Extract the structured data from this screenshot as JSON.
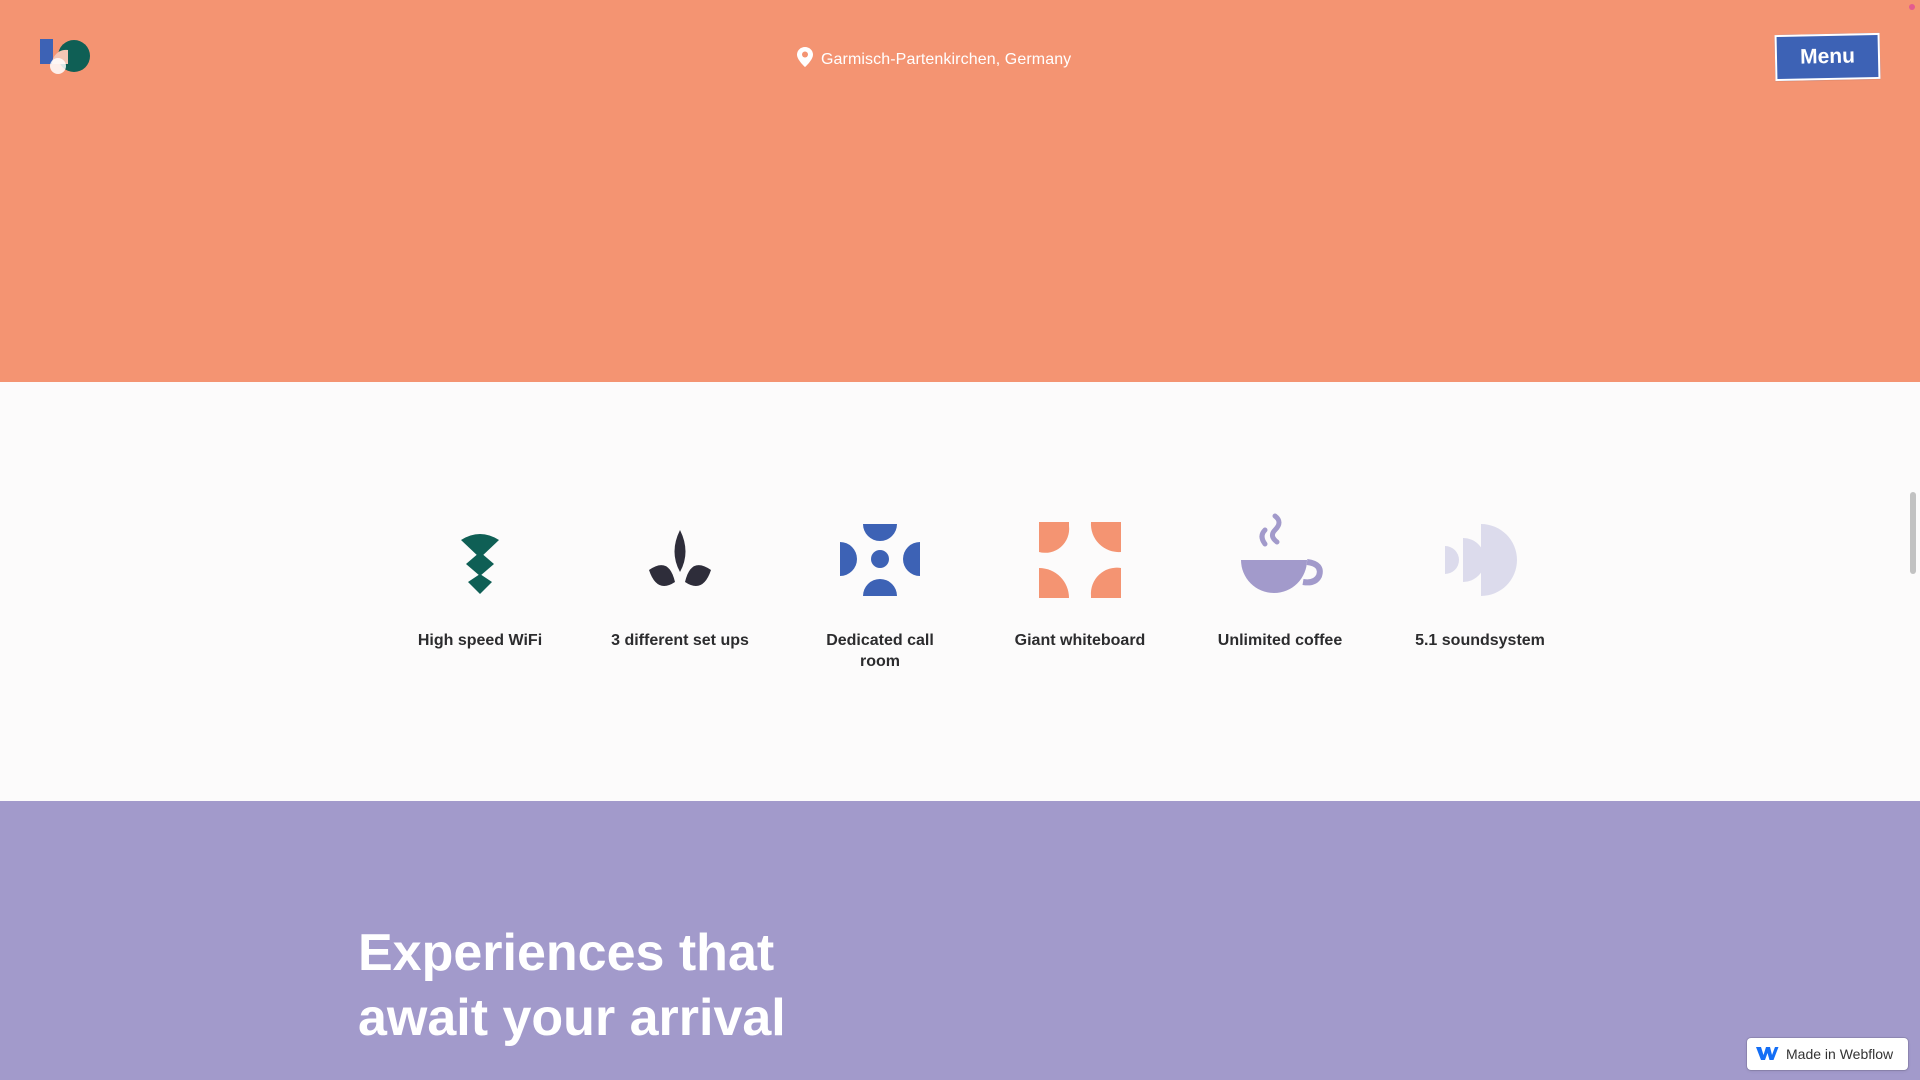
{
  "header": {
    "logo_icon": "brand-logo-icon",
    "location_icon": "map-pin-icon",
    "location_text": "Garmisch-Partenkirchen, Germany",
    "menu_label": "Menu"
  },
  "colors": {
    "hero_bg": "#f49472",
    "menu_bg": "#3d62b5",
    "experiences_bg": "#a29acb",
    "amenity_bg": "#fcfbfb"
  },
  "amenities": [
    {
      "icon": "wifi-icon",
      "label": "High speed WiFi"
    },
    {
      "icon": "plant-icon",
      "label": "3 different set ups"
    },
    {
      "icon": "call-room-icon",
      "label": "Dedicated call room"
    },
    {
      "icon": "whiteboard-icon",
      "label": "Giant whiteboard"
    },
    {
      "icon": "coffee-icon",
      "label": "Unlimited coffee"
    },
    {
      "icon": "speaker-icon",
      "label": "5.1 soundsystem"
    }
  ],
  "experiences": {
    "title": "Experiences that await your arrival"
  },
  "badge": {
    "icon": "webflow-icon",
    "label": "Made in Webflow"
  }
}
